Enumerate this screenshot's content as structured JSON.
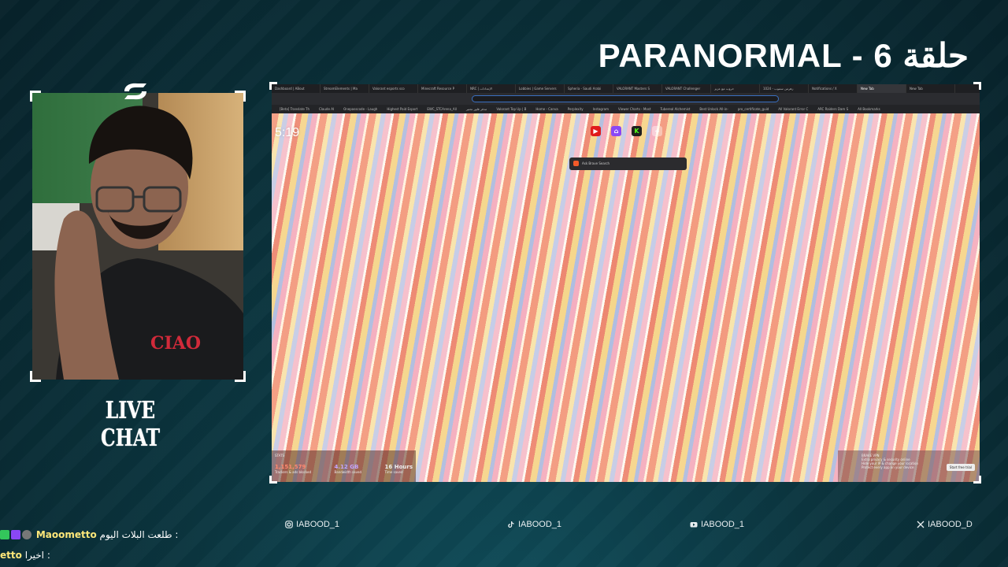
{
  "overlay": {
    "title": "PARANORMAL - 6 حلقة",
    "live_chat_label": "LIVE CHAT"
  },
  "browser": {
    "tabs": [
      "Dashboard | ABout",
      "StreamElements | Ma",
      "Valorant esports sco",
      "Minecraft Resource P",
      "NRC | الإعدادات",
      "Lobbies | Game Servers",
      "Spheria - Saudi Arabi",
      "VALORANT Masters S",
      "VALORANT Challenger",
      "حروب مع عزيز",
      "1024 - زهرمن سموب",
      "Notifications / X",
      "New Tab",
      "New Tab"
    ],
    "active_tab": 12,
    "bookmarks": [
      "[Beta] Translate Th",
      "Claude AI",
      "Onepasscode - Laugh",
      "Highest Paid Esport",
      "EWC_STCArena_All",
      "مدفر فلور تحتير",
      "Valorant Top Up | B",
      "Home - Canva",
      "Perplexity",
      "Instagram",
      "Viewer Charts - Most",
      "Tubereal Alchemist",
      "Best Unlock All-in-",
      "pro_certificate_guid",
      "All Valorant Error C",
      "ARC Raiders Dam S",
      "All Bookmarks"
    ],
    "clock": "5:19",
    "shortcuts": [
      {
        "name": "youtube-icon",
        "label": "YouTube",
        "glyph": "▶"
      },
      {
        "name": "twitch-icon",
        "label": "Twitch",
        "glyph": "⌂"
      },
      {
        "name": "kick-icon",
        "label": "KICK",
        "glyph": "K"
      },
      {
        "name": "add-site-icon",
        "label": "Add site",
        "glyph": "+"
      }
    ],
    "search_placeholder": "Ask Brave Search",
    "stats": {
      "heading": "STATS",
      "trackers_value": "1,151,579",
      "trackers_label": "Trackers & ads blocked",
      "bandwidth_value": "4.12 GB",
      "bandwidth_label": "Bandwidth saved",
      "time_value": "16 Hours",
      "time_label": "Time saved"
    },
    "vpn": {
      "heading": "BRAVE VPN",
      "line1": "Extra privacy & security online",
      "line2": "Hide your IP & change your location",
      "line3": "Protect every app on your device",
      "button": "Start free trial"
    }
  },
  "socials": [
    {
      "icon": "instagram-icon",
      "handle": "IABOOD_1"
    },
    {
      "icon": "tiktok-icon",
      "handle": "IABOOD_1"
    },
    {
      "icon": "youtube-icon",
      "handle": "IABOOD_1"
    },
    {
      "icon": "x-icon",
      "handle": "IABOOD_D"
    }
  ],
  "chat": [
    {
      "user": "Maoometto",
      "message": "طلعت البلات اليوم :"
    },
    {
      "user": "etto",
      "message": "اخيرا :"
    }
  ]
}
